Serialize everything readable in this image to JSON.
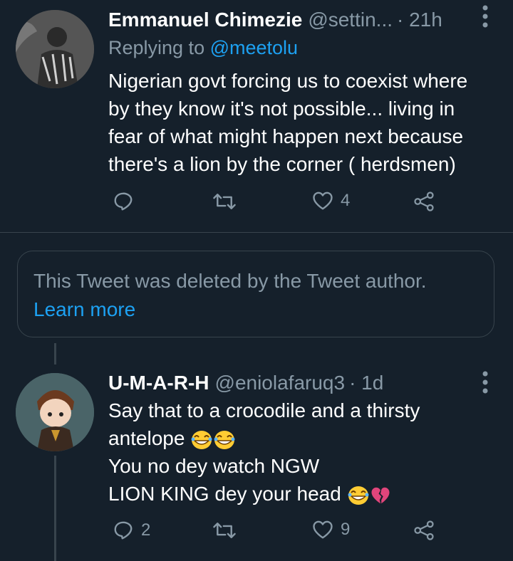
{
  "tweet1": {
    "display_name": "Emmanuel Chimezie",
    "handle": "@settin...",
    "time": "· 21h",
    "replying_prefix": "Replying to",
    "replying_to": "@meetolu",
    "text": "Nigerian govt forcing us to coexist where\nby they know it's not possible... living in\nfear of what might happen next because\nthere's a lion by the corner ( herdsmen)",
    "reply_count": "",
    "retweet_count": "",
    "like_count": "4"
  },
  "deleted_notice": {
    "text": "This Tweet was deleted by the Tweet author.",
    "link": "Learn more"
  },
  "tweet2": {
    "display_name": "U-M-A-R-H",
    "handle": "@eniolafaruq3",
    "time": "· 1d",
    "line1": "Say that to a crocodile and a thirsty",
    "line2": "antelope",
    "line3": "You no dey watch NGW",
    "line4": "LION KING dey your head",
    "reply_count": "2",
    "retweet_count": "",
    "like_count": "9"
  },
  "colors": {
    "background": "#15202b",
    "secondary_text": "#8899a6",
    "link": "#1da1f2",
    "border": "#38444d"
  },
  "icons": [
    "more-icon",
    "reply-icon",
    "retweet-icon",
    "like-icon",
    "share-icon",
    "laughing-emoji",
    "broken-heart-emoji"
  ]
}
